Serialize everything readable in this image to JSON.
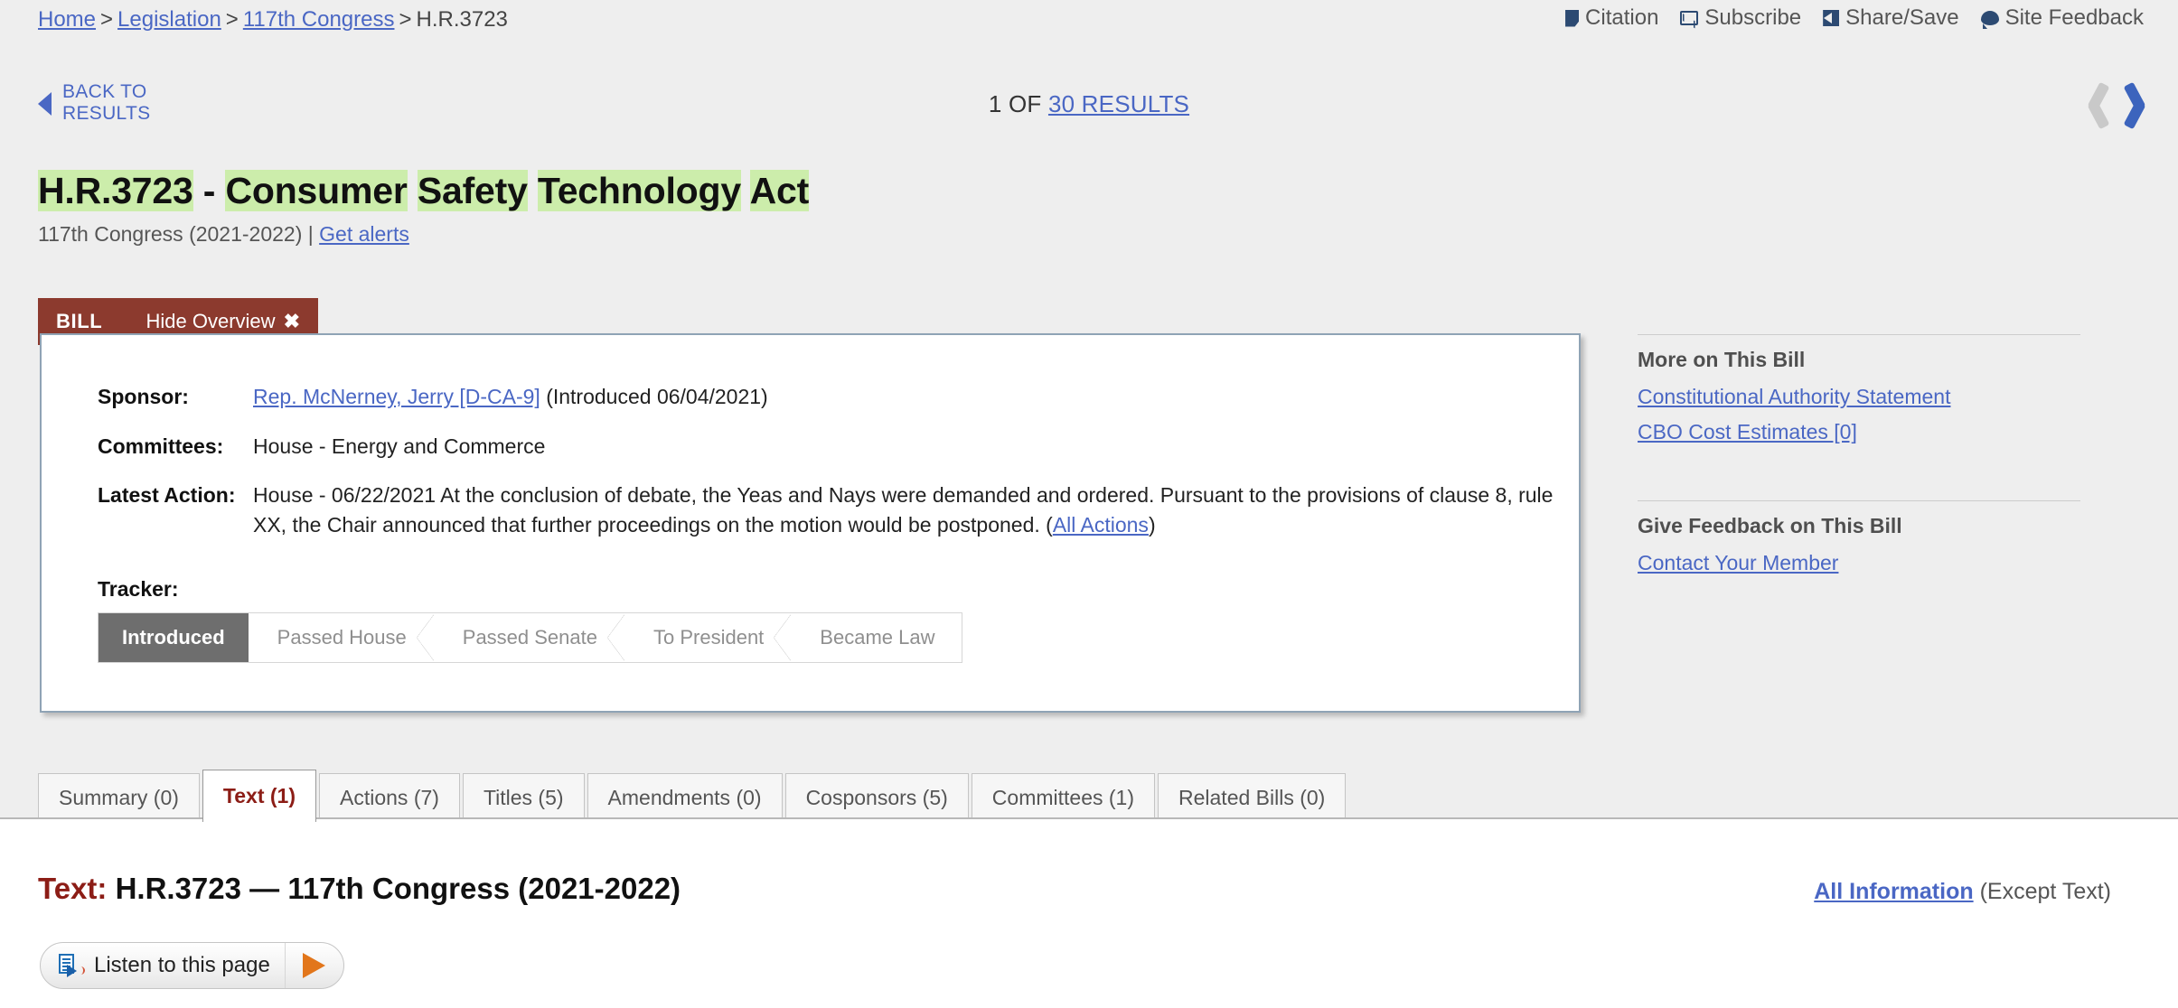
{
  "breadcrumb": {
    "items": [
      {
        "label": "Home",
        "link": true
      },
      {
        "label": "Legislation",
        "link": true
      },
      {
        "label": "117th Congress",
        "link": true
      },
      {
        "label": "H.R.3723",
        "link": false
      }
    ],
    "separator": ">"
  },
  "utility_bar": {
    "items": [
      {
        "label": "Citation",
        "icon": "citation-icon"
      },
      {
        "label": "Subscribe",
        "icon": "envelope-icon"
      },
      {
        "label": "Share/Save",
        "icon": "share-icon"
      },
      {
        "label": "Site Feedback",
        "icon": "chat-bubble-icon"
      }
    ]
  },
  "navigation": {
    "back_to_results": "BACK TO RESULTS",
    "counter_prefix": "1 OF",
    "counter_link": "30 RESULTS",
    "prev_enabled": false,
    "next_enabled": true
  },
  "bill": {
    "number": "H.R.3723",
    "dash": " - ",
    "title_words": [
      "Consumer",
      "Safety",
      "Technology",
      "Act"
    ],
    "congress_line": "117th Congress (2021-2022)",
    "separator": "|",
    "get_alerts": "Get alerts"
  },
  "overview": {
    "tab_label": "BILL",
    "hide_overview": "Hide Overview",
    "close_glyph": "✖",
    "rows": [
      {
        "label": "Sponsor:",
        "link_text": "Rep. McNerney, Jerry [D-CA-9]",
        "rest": " (Introduced 06/04/2021)"
      },
      {
        "label": "Committees:",
        "link_text": "",
        "rest": "House - Energy and Commerce"
      },
      {
        "label": "Latest Action:",
        "link_text": "",
        "rest": "House - 06/22/2021 At the conclusion of debate, the Yeas and Nays were demanded and ordered. Pursuant to the provisions of clause 8, rule XX, the Chair announced that further proceedings on the motion would be postponed.",
        "trailing_open": "  (",
        "trailing_link": "All Actions",
        "trailing_close": ")"
      }
    ],
    "tracker_label": "Tracker:",
    "tracker_steps": [
      {
        "label": "Introduced",
        "active": true
      },
      {
        "label": "Passed House",
        "active": false
      },
      {
        "label": "Passed Senate",
        "active": false
      },
      {
        "label": "To President",
        "active": false
      },
      {
        "label": "Became Law",
        "active": false
      }
    ]
  },
  "sidebar": {
    "more_heading": "More on This Bill",
    "more_links": [
      "Constitutional Authority Statement",
      "CBO Cost Estimates [0]"
    ],
    "feedback_heading": "Give Feedback on This Bill",
    "feedback_links": [
      "Contact Your Member"
    ]
  },
  "tabs": [
    {
      "label": "Summary (0)",
      "active": false
    },
    {
      "label": "Text (1)",
      "active": true
    },
    {
      "label": "Actions (7)",
      "active": false
    },
    {
      "label": "Titles (5)",
      "active": false
    },
    {
      "label": "Amendments (0)",
      "active": false
    },
    {
      "label": "Cosponsors (5)",
      "active": false
    },
    {
      "label": "Committees (1)",
      "active": false
    },
    {
      "label": "Related Bills (0)",
      "active": false
    }
  ],
  "content": {
    "heading_prefix": "Text:",
    "heading_rest": " H.R.3723 — 117th Congress (2021-2022)",
    "all_information_link": "All Information",
    "all_information_rest": " (Except Text)",
    "readspeaker_label": "Listen to this page"
  },
  "colors": {
    "page_background": "#eeeeee",
    "link_blue": "#4a67c4",
    "bill_tab_red": "#8c3a2e",
    "active_tab_red": "#8c1d16",
    "highlight_green": "#ccedab",
    "tracker_active_gray": "#6e6e6e",
    "next_arrow_blue": "#3c64bd",
    "prev_arrow_gray": "#c9c9c9",
    "play_orange": "#e2761b"
  }
}
